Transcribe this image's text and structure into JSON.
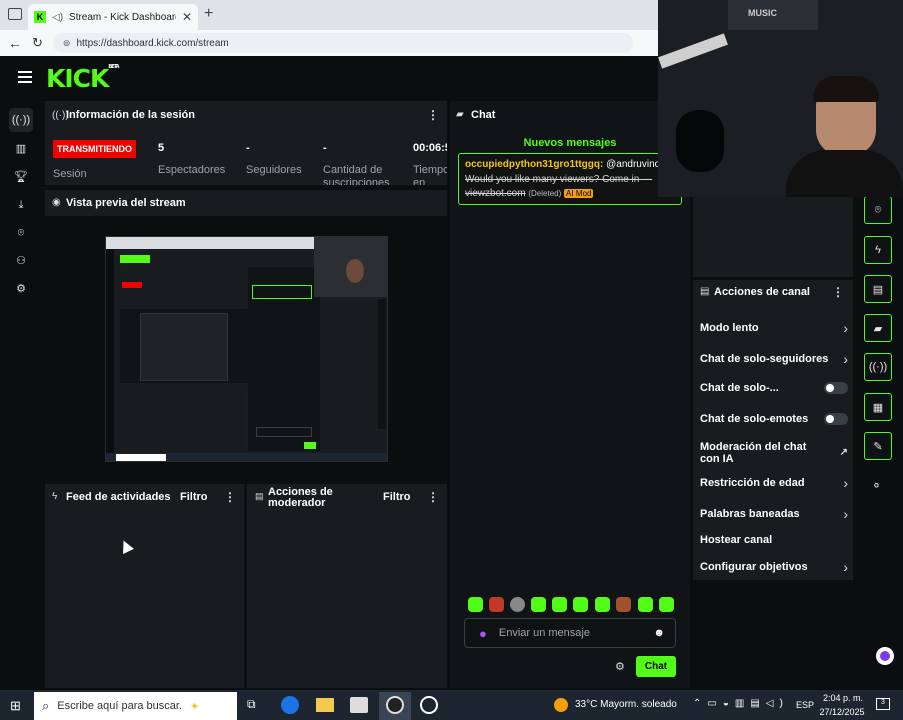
{
  "browser": {
    "tab_title": "Stream - Kick Dashboard",
    "url": "https://dashboard.kick.com/stream",
    "favicon_letter": "K"
  },
  "logo": {
    "text": "KICK",
    "sup": "BETA"
  },
  "session": {
    "title": "Información de la sesión",
    "status_badge": "TRANSMITIENDO",
    "status_label": "Sesión",
    "stats": [
      {
        "value": "5",
        "label": "Espectadores"
      },
      {
        "value": "-",
        "label": "Seguidores"
      },
      {
        "value": "-",
        "label": "Cantidad de suscripciones"
      },
      {
        "value": "00:06:5",
        "label": "Tiempo en vivo"
      }
    ]
  },
  "preview": {
    "title": "Vista previa del stream"
  },
  "activity_feed": {
    "title": "Feed de actividades",
    "filter_label": "Filtro"
  },
  "mod_actions": {
    "title": "Acciones de moderador",
    "filter_label": "Filtro"
  },
  "chat": {
    "title": "Chat",
    "new_messages_label": "Nuevos mensajes",
    "message": {
      "username": "occupiedpython31gro1ttggq:",
      "mention": "@andruvinotin",
      "text": "Would you like many viewers? Come in — viewzbot.com",
      "deleted_tag": "(Deleted)",
      "mod_tag": "AI Mod"
    },
    "input_placeholder": "Enviar un mensaje",
    "send_label": "Chat"
  },
  "channel_actions": {
    "title": "Acciones de canal",
    "items": [
      {
        "label": "Modo lento",
        "control": "chevron"
      },
      {
        "label": "Chat de solo-seguidores",
        "control": "chevron"
      },
      {
        "label": "Chat de solo-...",
        "control": "toggle",
        "on": false
      },
      {
        "label": "Chat de solo-emotes",
        "control": "toggle",
        "on": false
      },
      {
        "label": "Moderación del chat con IA",
        "control": "external"
      },
      {
        "label": "Restricción de edad",
        "control": "chevron"
      },
      {
        "label": "Palabras baneadas",
        "control": "chevron"
      },
      {
        "label": "Hostear canal",
        "control": "none"
      },
      {
        "label": "Configurar objetivos",
        "control": "chevron"
      }
    ]
  },
  "webcam": {
    "sign_text": "MUSIC"
  },
  "taskbar": {
    "search_placeholder": "Escribe aquí para buscar.",
    "weather": "33°C  Mayorm. soleado",
    "language": "ESP",
    "time": "2:04 p. m.",
    "date": "27/12/2025",
    "notifications": "3"
  },
  "colors": {
    "accent": "#53fc18",
    "live": "#eb0400",
    "panel": "#191b1f",
    "background": "#0b0e0f"
  }
}
